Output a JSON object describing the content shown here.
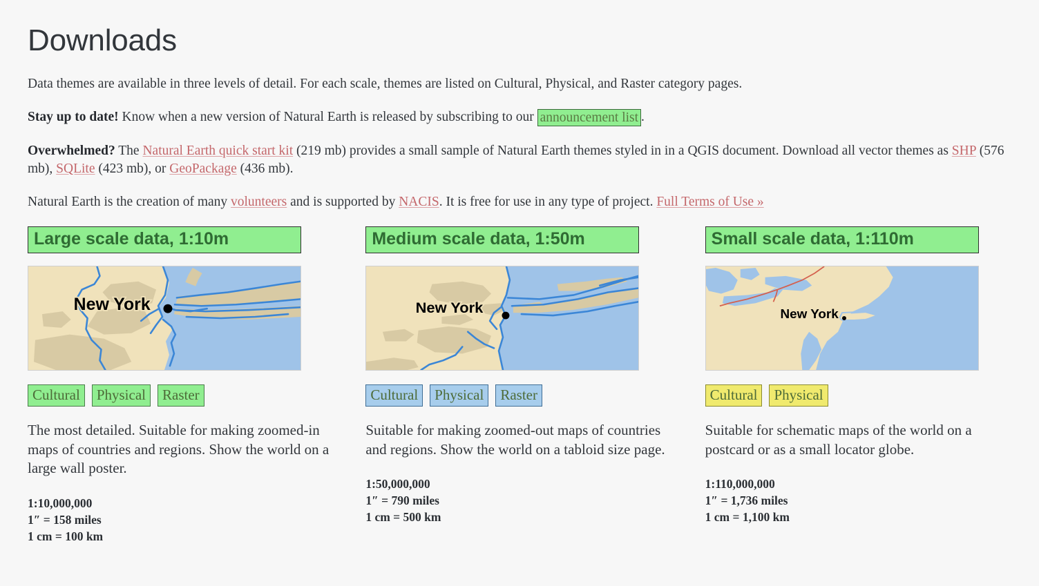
{
  "page": {
    "title": "Downloads",
    "background_color": "#f7f7f7",
    "link_color": "#c4676b"
  },
  "intro": {
    "p1": "Data themes are available in three levels of detail. For each scale, themes are listed on Cultural, Physical, and Raster category pages.",
    "p2_lead": "Stay up to date!",
    "p2_text": " Know when a new version of Natural Earth is released by subscribing to our ",
    "p2_link": "announcement list",
    "p2_tail": ".",
    "p3_lead": "Overwhelmed?",
    "p3_a": " The ",
    "p3_link1": "Natural Earth quick start kit",
    "p3_b": " (219 mb) provides a small sample of Natural Earth themes styled in in a QGIS document. Download all vector themes as ",
    "p3_link2": "SHP",
    "p3_c": " (576 mb), ",
    "p3_link3": "SQLite",
    "p3_d": " (423 mb), or ",
    "p3_link4": "GeoPackage",
    "p3_e": " (436 mb).",
    "p4_a": "Natural Earth is the creation of many ",
    "p4_link1": "volunteers",
    "p4_b": " and is supported by ",
    "p4_link2": "NACIS",
    "p4_c": ". It is free for use in any type of project. ",
    "p4_link3": "Full Terms of Use »"
  },
  "columns": [
    {
      "header": "Large scale data, 1:10m",
      "map_label": "New York",
      "badge_style": "green",
      "badges": [
        "Cultural",
        "Physical",
        "Raster"
      ],
      "description": "The most detailed. Suitable for making zoomed-in maps of countries and regions. Show the world on a large wall poster.",
      "scale_ratio": "1:10,000,000",
      "scale_inch": "1″ = 158 miles",
      "scale_cm": "1 cm = 100 km"
    },
    {
      "header": "Medium scale data, 1:50m",
      "map_label": "New York",
      "badge_style": "blue",
      "badges": [
        "Cultural",
        "Physical",
        "Raster"
      ],
      "description": "Suitable for making zoomed-out maps of countries and regions. Show the world on a tabloid size page.",
      "scale_ratio": "1:50,000,000",
      "scale_inch": "1″ = 790 miles",
      "scale_cm": "1 cm = 500 km"
    },
    {
      "header": "Small scale data, 1:110m",
      "map_label": "New York",
      "badge_style": "yellow",
      "badges": [
        "Cultural",
        "Physical"
      ],
      "description": "Suitable for schematic maps of the world on a postcard or as a small locator globe.",
      "scale_ratio": "1:110,000,000",
      "scale_inch": "1″ = 1,736 miles",
      "scale_cm": "1 cm = 1,100 km"
    }
  ],
  "map_colors": {
    "land": "#f0e2bb",
    "water": "#9fc3e8",
    "urban": "#d8caa4",
    "river": "#3b86d6",
    "border": "#d4604e",
    "city_dot": "#000000"
  }
}
